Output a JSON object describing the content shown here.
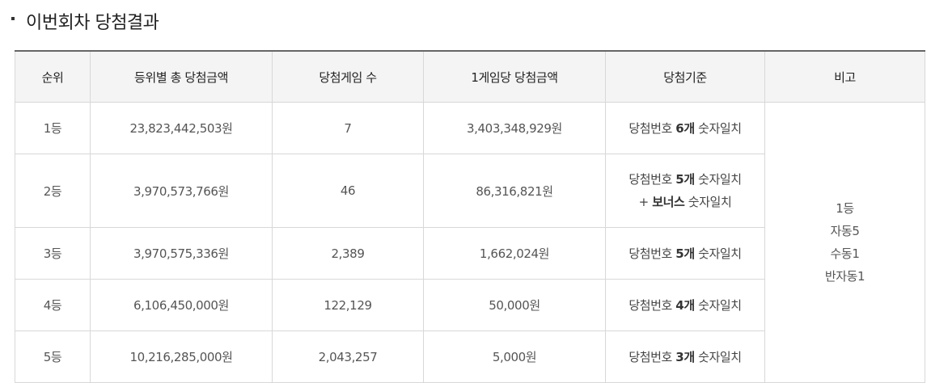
{
  "section": {
    "title": "이번회차 당첨결과"
  },
  "table": {
    "headers": [
      "순위",
      "등위별 총 당첨금액",
      "당첨게임 수",
      "1게임당 당첨금액",
      "당첨기준",
      "비고"
    ],
    "rows": [
      {
        "rank": "1등",
        "total": "23,823,442,503원",
        "winners": "7",
        "per_game": "3,403,348,929원",
        "criteria": {
          "prefix": "당첨번호 ",
          "count": "6개",
          "suffix": " 숫자일치"
        }
      },
      {
        "rank": "2등",
        "total": "3,970,573,766원",
        "winners": "46",
        "per_game": "86,316,821원",
        "criteria": {
          "prefix": "당첨번호 ",
          "count": "5개",
          "suffix": " 숫자일치",
          "line2_prefix": "+ ",
          "bonus": "보너스",
          "line2_suffix": " 숫자일치"
        }
      },
      {
        "rank": "3등",
        "total": "3,970,575,336원",
        "winners": "2,389",
        "per_game": "1,662,024원",
        "criteria": {
          "prefix": "당첨번호 ",
          "count": "5개",
          "suffix": " 숫자일치"
        }
      },
      {
        "rank": "4등",
        "total": "6,106,450,000원",
        "winners": "122,129",
        "per_game": "50,000원",
        "criteria": {
          "prefix": "당첨번호 ",
          "count": "4개",
          "suffix": " 숫자일치"
        }
      },
      {
        "rank": "5등",
        "total": "10,216,285,000원",
        "winners": "2,043,257",
        "per_game": "5,000원",
        "criteria": {
          "prefix": "당첨번호 ",
          "count": "3개",
          "suffix": " 숫자일치"
        }
      }
    ],
    "note": [
      "1등",
      "자동5",
      "수동1",
      "반자동1"
    ]
  }
}
